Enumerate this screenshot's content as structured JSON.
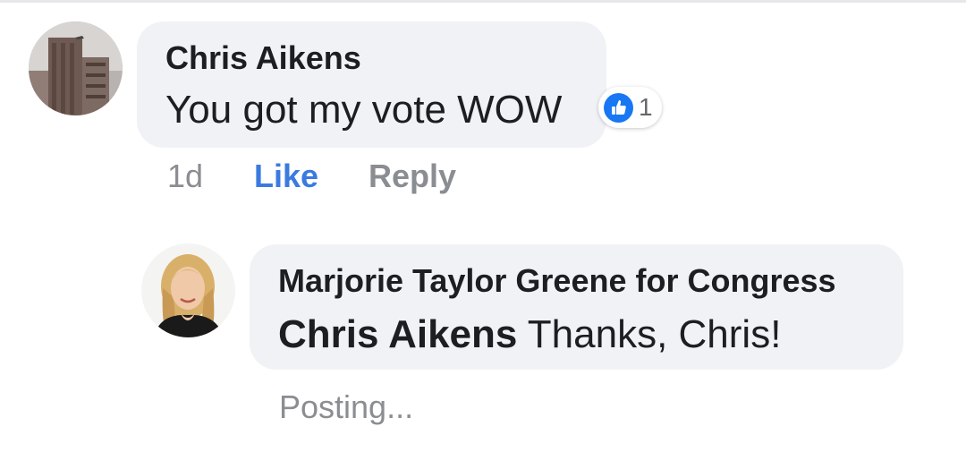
{
  "comment": {
    "author": "Chris Aikens",
    "text": "You got my vote WOW",
    "reaction_count": "1",
    "time": "1d",
    "like_label": "Like",
    "reply_label": "Reply",
    "reaction_icon": "like-icon"
  },
  "reply": {
    "author": "Marjorie Taylor Greene for Congress",
    "mention": "Chris Aikens",
    "text": " Thanks, Chris!",
    "status": "Posting..."
  },
  "colors": {
    "bubble": "#f0f2f5",
    "text": "#1c1e21",
    "muted": "#8a8d91",
    "link": "#3b7be0",
    "like_blue": "#1877f2"
  }
}
